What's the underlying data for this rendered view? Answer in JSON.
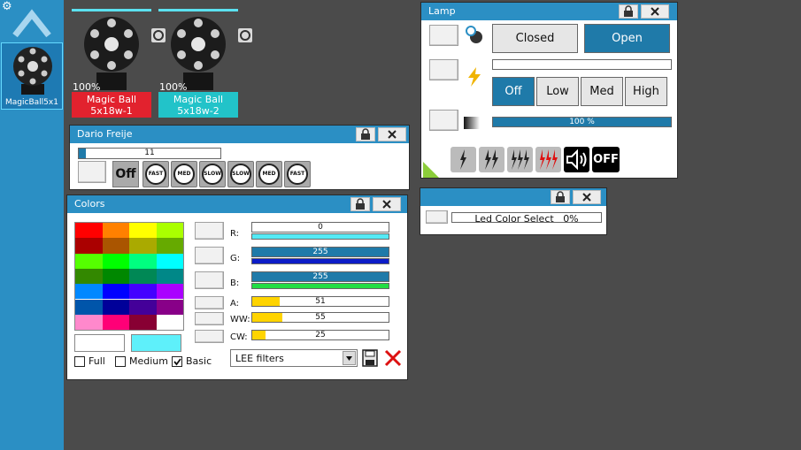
{
  "sidebar": {
    "fixture_name": "MagicBall5x1"
  },
  "fixtures": [
    {
      "percent": "100%",
      "name": "Magic Ball",
      "sub": "5x18w-1",
      "color": "#e2222e"
    },
    {
      "percent": "100%",
      "name": "Magic Ball",
      "sub": "5x18w-2",
      "color": "#22c3c9"
    }
  ],
  "dario": {
    "title": "Dario Freije",
    "slider_value": "11",
    "slider_fraction": 0.05,
    "off_label": "Off",
    "speed_buttons": [
      "FAST",
      "MED",
      "SLOW",
      "SLOW",
      "MED",
      "FAST"
    ]
  },
  "colors": {
    "title": "Colors",
    "palette": [
      [
        "#ff0000",
        "#ff8000",
        "#ffff00",
        "#aaff00"
      ],
      [
        "#aa0000",
        "#aa5500",
        "#aaaa00",
        "#66aa00"
      ],
      [
        "#55ff00",
        "#00ff00",
        "#00ff80",
        "#00ffff"
      ],
      [
        "#338800",
        "#008800",
        "#008855",
        "#008888"
      ],
      [
        "#0088ff",
        "#0000ff",
        "#4400ff",
        "#aa00ff"
      ],
      [
        "#0055aa",
        "#000099",
        "#440099",
        "#880088"
      ],
      [
        "#ff88cc",
        "#ff0077",
        "#880033",
        "#ffffff"
      ]
    ],
    "preview_1": "#ffffff",
    "preview_2": "#5ef0fa",
    "channels": [
      {
        "label": "R:",
        "value": "0",
        "fraction": 0.0,
        "fill": "#1f7aa9",
        "sub": "#55eaf5"
      },
      {
        "label": "G:",
        "value": "255",
        "fraction": 1.0,
        "fill": "#1f7aa9",
        "sub": "#0c1cc8"
      },
      {
        "label": "B:",
        "value": "255",
        "fraction": 1.0,
        "fill": "#1f7aa9",
        "sub": "#22dd44"
      },
      {
        "label": "A:",
        "value": "51",
        "fraction": 0.2,
        "fill": "#ffd400",
        "sub": null
      },
      {
        "label": "WW:",
        "value": "55",
        "fraction": 0.22,
        "fill": "#ffd400",
        "sub": null
      },
      {
        "label": "CW:",
        "value": "25",
        "fraction": 0.1,
        "fill": "#ffd400",
        "sub": null
      }
    ],
    "options": [
      "Full",
      "Medium",
      "Basic"
    ],
    "checked": [
      false,
      false,
      true
    ],
    "filter_select": "LEE filters"
  },
  "lamp": {
    "title": "Lamp",
    "closed_label": "Closed",
    "open_label": "Open",
    "levels": [
      "Off",
      "Low",
      "Med",
      "High"
    ],
    "active_level": 0,
    "dimmer_value": "100 %",
    "dimmer_fraction": 1.0,
    "strobe_off_label": "OFF"
  },
  "led": {
    "label": "Led Color Select",
    "value": "0%"
  }
}
